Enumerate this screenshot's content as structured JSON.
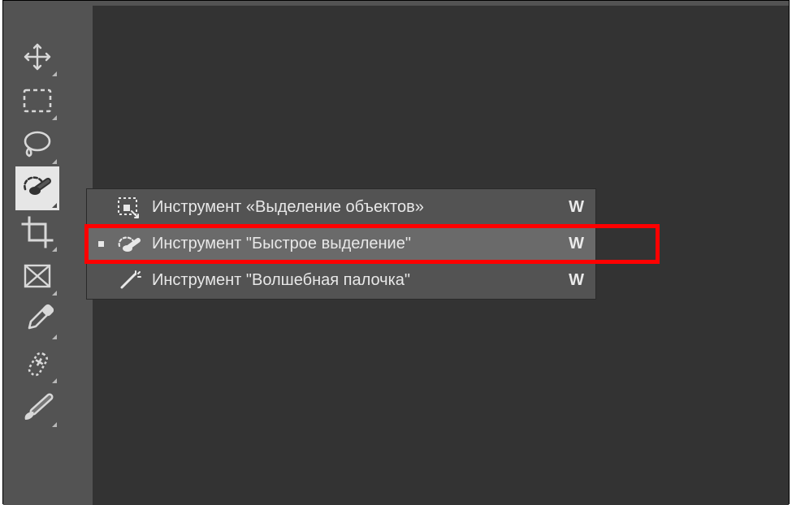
{
  "toolbar": {
    "tools": [
      {
        "name": "move-tool"
      },
      {
        "name": "marquee-tool"
      },
      {
        "name": "lasso-tool"
      },
      {
        "name": "quick-selection-tool",
        "active": true
      },
      {
        "name": "crop-tool"
      },
      {
        "name": "frame-tool"
      },
      {
        "name": "eyedropper-tool"
      },
      {
        "name": "healing-brush-tool"
      },
      {
        "name": "brush-tool"
      }
    ]
  },
  "flyout": {
    "items": [
      {
        "name": "object-selection-tool",
        "label": "Инструмент «Выделение объектов»",
        "shortcut": "W",
        "active": false
      },
      {
        "name": "quick-selection-tool",
        "label": "Инструмент \"Быстрое выделение\"",
        "shortcut": "W",
        "active": true
      },
      {
        "name": "magic-wand-tool",
        "label": "Инструмент \"Волшебная палочка\"",
        "shortcut": "W",
        "active": false
      }
    ]
  }
}
